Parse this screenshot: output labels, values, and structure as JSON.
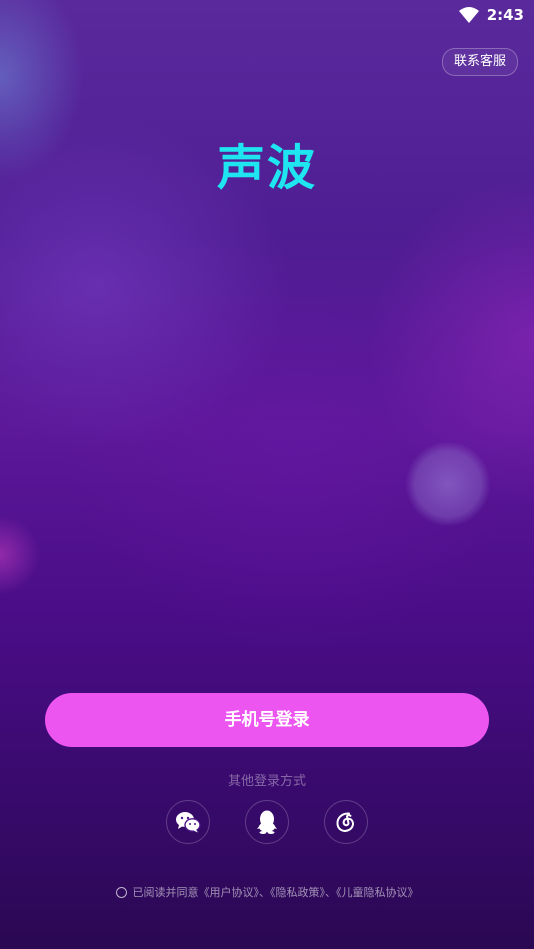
{
  "status_bar": {
    "time": "2:43",
    "wifi_icon": "wifi-icon"
  },
  "header": {
    "support_label": "联系客服"
  },
  "logo": {
    "text": "声波",
    "color": "#1ee5f0"
  },
  "login": {
    "phone_login_label": "手机号登录",
    "phone_login_color": "#ec55f0",
    "other_methods_label": "其他登录方式",
    "social_icons": [
      "wechat-icon",
      "qq-icon",
      "netease-music-icon"
    ]
  },
  "agreement": {
    "text": "已阅读并同意《用户协议》、《隐私政策》、《儿童隐私协议》"
  }
}
